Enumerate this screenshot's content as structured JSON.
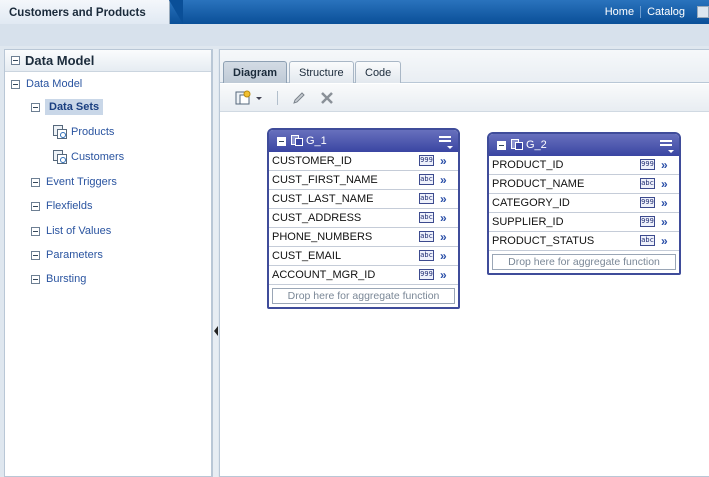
{
  "header": {
    "title": "Customers and Products",
    "links": [
      "Home",
      "Catalog"
    ]
  },
  "left_panel": {
    "title": "Data Model",
    "tree": {
      "root": "Data Model",
      "data_sets_label": "Data Sets",
      "data_sets": [
        "Products",
        "Customers"
      ],
      "items": [
        "Event Triggers",
        "Flexfields",
        "List of Values",
        "Parameters",
        "Bursting"
      ]
    }
  },
  "main": {
    "tabs": [
      "Diagram",
      "Structure",
      "Code"
    ],
    "active_tab": "Diagram",
    "groups": [
      {
        "name": "G_1",
        "fields": [
          {
            "name": "CUSTOMER_ID",
            "type": "999"
          },
          {
            "name": "CUST_FIRST_NAME",
            "type": "abc"
          },
          {
            "name": "CUST_LAST_NAME",
            "type": "abc"
          },
          {
            "name": "CUST_ADDRESS",
            "type": "abc"
          },
          {
            "name": "PHONE_NUMBERS",
            "type": "abc"
          },
          {
            "name": "CUST_EMAIL",
            "type": "abc"
          },
          {
            "name": "ACCOUNT_MGR_ID",
            "type": "999"
          }
        ],
        "dropzone": "Drop here for aggregate function"
      },
      {
        "name": "G_2",
        "fields": [
          {
            "name": "PRODUCT_ID",
            "type": "999"
          },
          {
            "name": "PRODUCT_NAME",
            "type": "abc"
          },
          {
            "name": "CATEGORY_ID",
            "type": "999"
          },
          {
            "name": "SUPPLIER_ID",
            "type": "999"
          },
          {
            "name": "PRODUCT_STATUS",
            "type": "abc"
          }
        ],
        "dropzone": "Drop here for aggregate function"
      }
    ]
  },
  "colors": {
    "header_blue": "#0a4f98",
    "group_border": "#3f4c9a",
    "link_blue": "#2a54a0"
  }
}
